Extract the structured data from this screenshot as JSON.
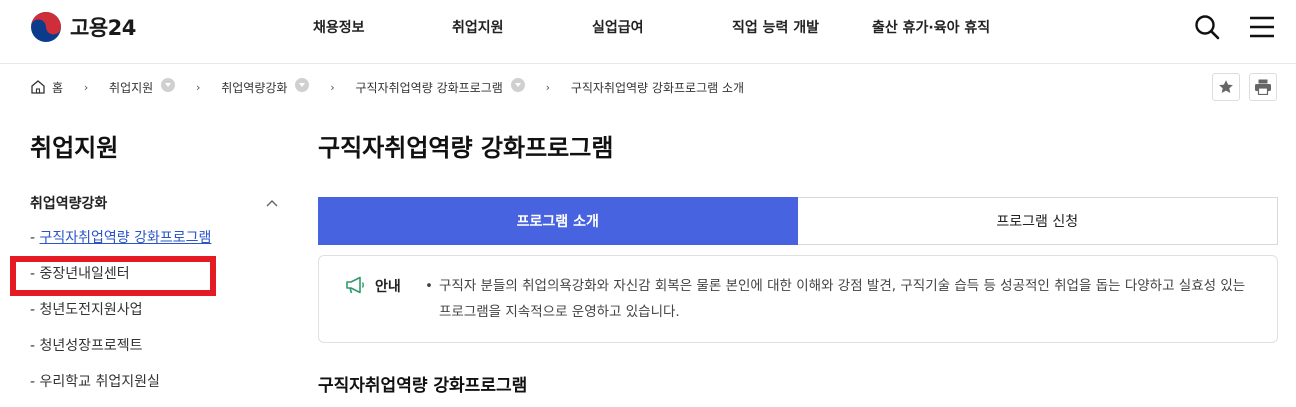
{
  "header": {
    "logo_text": "고용24",
    "nav": [
      "채용정보",
      "취업지원",
      "실업급여",
      "직업 능력 개발",
      "출산 휴가·육아 휴직"
    ]
  },
  "breadcrumb": {
    "home": "홈",
    "items": [
      "취업지원",
      "취업역량강화",
      "구직자취업역량 강화프로그램",
      "구직자취업역량 강화프로그램 소개"
    ]
  },
  "sidebar": {
    "title": "취업지원",
    "group": "취업역량강화",
    "items": [
      {
        "label": "구직자취업역량 강화프로그램"
      },
      {
        "label": "중장년내일센터"
      },
      {
        "label": "청년도전지원사업"
      },
      {
        "label": "청년성장프로젝트"
      },
      {
        "label": "우리학교 취업지원실"
      }
    ]
  },
  "main": {
    "title": "구직자취업역량 강화프로그램",
    "tabs": [
      "프로그램 소개",
      "프로그램 신청"
    ],
    "notice": {
      "label": "안내",
      "text": "구직자 분들의 취업의욕강화와 자신감 회복은 물론 본인에 대한 이해와 강점 발견, 구직기술 습득 등 성공적인 취업을 돕는 다양하고 실효성 있는 프로그램을 지속적으로 운영하고 있습니다."
    },
    "section_title": "구직자취업역량 강화프로그램"
  },
  "colors": {
    "accent": "#4863df",
    "link": "#2b54c9",
    "highlight": "#e51b24",
    "notice_icon": "#2e9c6a"
  }
}
